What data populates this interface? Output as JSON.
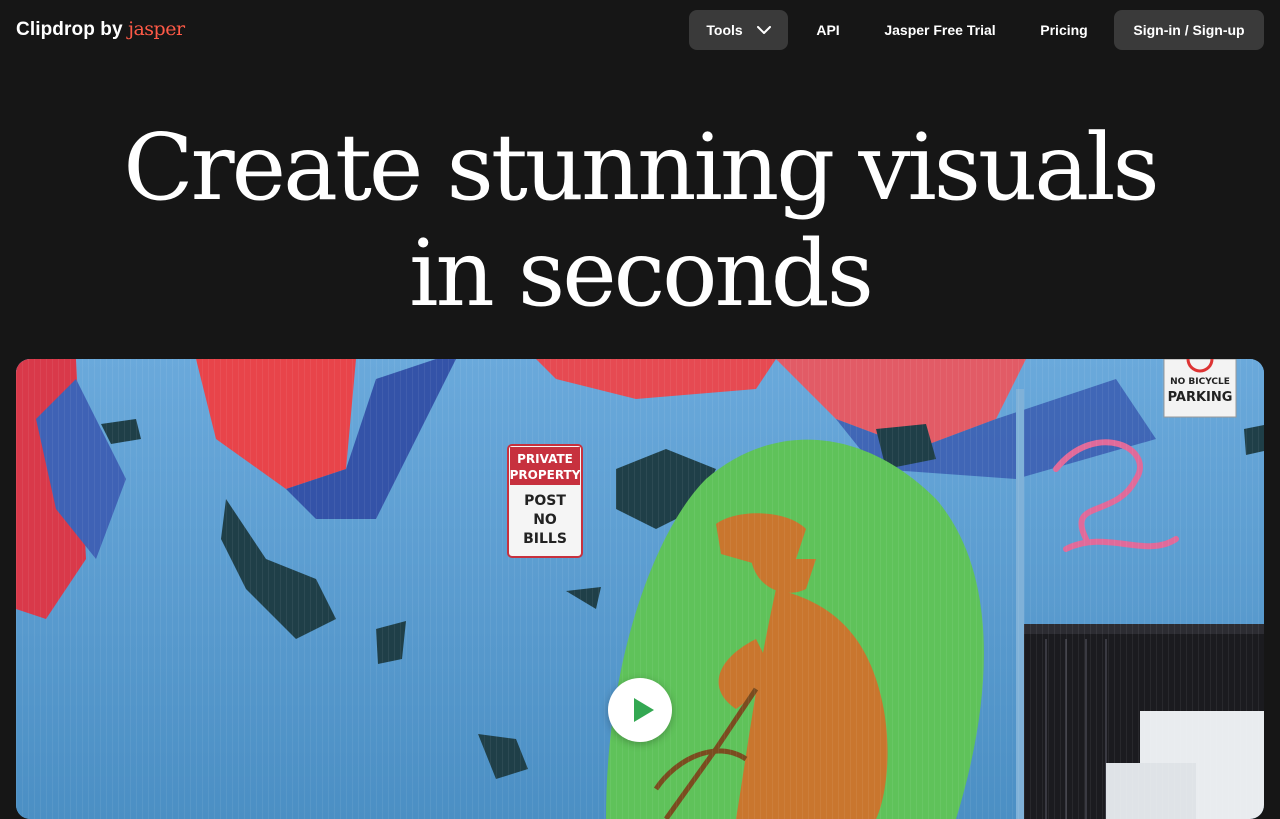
{
  "header": {
    "brand_name": "Clipdrop",
    "brand_by": "by",
    "brand_partner": "jasper",
    "nav": {
      "tools": "Tools",
      "api": "API",
      "trial": "Jasper Free Trial",
      "pricing": "Pricing",
      "signin": "Sign-in / Sign-up"
    }
  },
  "hero": {
    "line1": "Create stunning visuals",
    "line2": "in seconds"
  },
  "media": {
    "sign_private": [
      "PRIVATE",
      "PROPERTY",
      "POST",
      "NO",
      "BILLS"
    ],
    "sign_parking": [
      "NO BICYCLE",
      "PARKING"
    ],
    "play_icon": "play-icon"
  },
  "colors": {
    "background": "#161616",
    "button_bg": "#3a3a3a",
    "brand_accent": "#ff5a47",
    "play_accent": "#33a852"
  }
}
